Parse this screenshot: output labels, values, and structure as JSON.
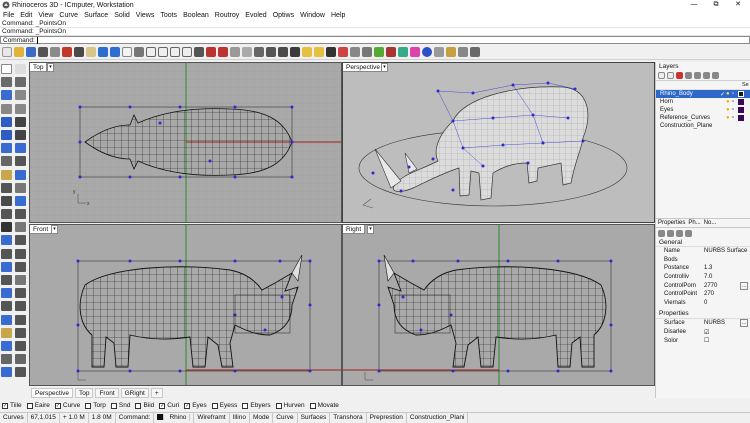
{
  "app": {
    "title": "Rhinoceros 3D - ICmputer, Workstation",
    "window_buttons": [
      "—",
      "⧉",
      "✕"
    ]
  },
  "menu": [
    "File",
    "Edit",
    "View",
    "Curve",
    "Surface",
    "Solid",
    "Views",
    "Toots",
    "Boolean",
    "Routroy",
    "Evoled",
    "Optiws",
    "Window",
    "Help"
  ],
  "command_history": [
    "Command: _PointsOn",
    "Command: _PointsOn"
  ],
  "command_prompt": "Command:",
  "viewports": {
    "top": "Top",
    "perspective": "Perspective",
    "front": "Front",
    "right": "Right"
  },
  "viewport_tabs": [
    "Perspective",
    "Top",
    "Front",
    "GRight"
  ],
  "viewport_tab_add": "+",
  "osnaps": [
    {
      "label": "Tiile",
      "checked": true
    },
    {
      "label": "Eaire",
      "checked": false
    },
    {
      "label": "Curve",
      "checked": true
    },
    {
      "label": "Torp",
      "checked": false
    },
    {
      "label": "Snd",
      "checked": false
    },
    {
      "label": "Biid",
      "checked": false
    },
    {
      "label": "Curi",
      "checked": true
    },
    {
      "label": "Eyes",
      "checked": true
    },
    {
      "label": "Eyess",
      "checked": false
    },
    {
      "label": "Ebyers",
      "checked": false
    },
    {
      "label": "Hurven",
      "checked": false
    },
    {
      "label": "Movate",
      "checked": false
    }
  ],
  "statusbar": [
    "Curves",
    "67,1.015",
    "+ 1.0 M",
    "1.8 0M",
    "Command:",
    "Rhino",
    "Wireframt",
    "Illino",
    "Mode",
    "Curve",
    "Surfaces",
    "Transhora",
    "Preprestion",
    "Construction_Plani"
  ],
  "layers": {
    "title": "Layers",
    "header_extra": "Se",
    "items": [
      {
        "name": "Rhino_Body",
        "selected": true,
        "color": "#1a1a1a"
      },
      {
        "name": "Horn",
        "selected": false,
        "color": "#3a0a5a"
      },
      {
        "name": "Eyes",
        "selected": false,
        "color": "#3a0a5a"
      },
      {
        "name": "Reference_Curves",
        "selected": false,
        "color": "#3a0a5a"
      },
      {
        "name": "Construction_Plane",
        "selected": false,
        "color": "#ffffff"
      }
    ]
  },
  "properties": {
    "tabs": [
      "Properties",
      "Ph...",
      "No..."
    ],
    "general_title": "General",
    "general": [
      {
        "k": "Name",
        "v": "NURBS Surface"
      },
      {
        "k": "Bods",
        "v": ""
      },
      {
        "k": "Postance",
        "v": "1.3"
      },
      {
        "k": "Controlliv",
        "v": "7.0"
      },
      {
        "k": "ControlPorn",
        "v": "2770",
        "btn": "..."
      },
      {
        "k": "ControlPoint",
        "v": "270"
      },
      {
        "k": "Viernals",
        "v": "0"
      }
    ],
    "properties_title": "Properties",
    "props": [
      {
        "k": "Surface",
        "v": "NURBS",
        "btn": "..."
      },
      {
        "k": "Disarlee",
        "v": "☑"
      },
      {
        "k": "Solor",
        "v": "☐"
      }
    ]
  },
  "colors": {
    "viewport_bg": "#a9a9a9",
    "selected_layer": "#2c67c9",
    "control_point": "#2b2bd0",
    "mesh": "#111111"
  }
}
